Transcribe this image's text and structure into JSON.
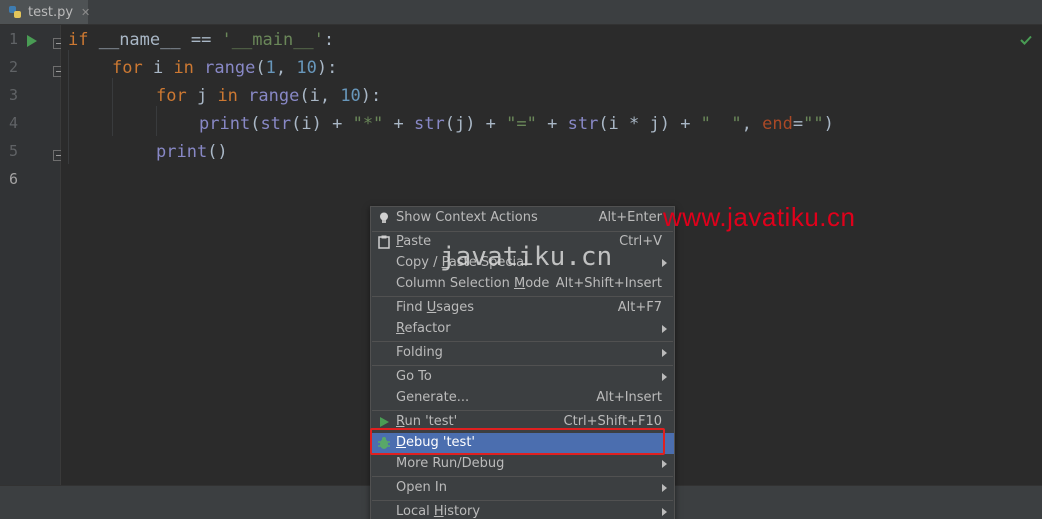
{
  "tab": {
    "filename": "test.py",
    "close_glyph": "✕"
  },
  "gutter": {
    "line_numbers": [
      "1",
      "2",
      "3",
      "4",
      "5",
      "6"
    ]
  },
  "code": {
    "line1": {
      "kw_if": "if",
      "name": " __name__ == ",
      "str_main": "'__main__'",
      "colon": ":"
    },
    "line2": {
      "kw_for": "for",
      "i": " i ",
      "kw_in": "in",
      "sp": " ",
      "range": "range",
      "open": "(",
      "n1": "1",
      "comma": ", ",
      "n10": "10",
      "close": "):"
    },
    "line3": {
      "kw_for": "for",
      "j": " j ",
      "kw_in": "in",
      "sp": " ",
      "range": "range",
      "args": "(i, ",
      "n10": "10",
      "close": "):"
    },
    "line4": {
      "print": "print",
      "p1": "(",
      "str1": "str",
      "a1": "(i) + ",
      "s_star": "\"*\"",
      "a2": " + ",
      "str2": "str",
      "a3": "(j) + ",
      "s_eq": "\"=\"",
      "a4": " + ",
      "str3": "str",
      "a5": "(i * j) + ",
      "s_sp": "\"  \"",
      "a6": ", ",
      "end": "end",
      "a7": "=",
      "s_empty": "\"\"",
      "a8": ")"
    },
    "line5": {
      "print": "print",
      "paren": "()"
    }
  },
  "watermarks": {
    "red": "www.javatiku.cn",
    "gray": "javatiku.cn"
  },
  "context_menu": {
    "show_context_actions": {
      "label": "Show Context Actions",
      "shortcut": "Alt+Enter",
      "icon": "bulb-icon"
    },
    "paste": {
      "label_u": "P",
      "label_rest": "aste",
      "shortcut": "Ctrl+V",
      "icon": "clipboard-icon"
    },
    "copy_paste_special": {
      "label_a": "Copy / ",
      "label_u": "P",
      "label_b": "aste Special"
    },
    "column_selection_mode": {
      "label_a": "Column Selection ",
      "label_u": "M",
      "label_b": "ode",
      "shortcut": "Alt+Shift+Insert"
    },
    "find_usages": {
      "label_a": "Find ",
      "label_u": "U",
      "label_b": "sages",
      "shortcut": "Alt+F7"
    },
    "refactor": {
      "label_u": "R",
      "label_rest": "efactor"
    },
    "folding": {
      "label": "Folding"
    },
    "go_to": {
      "label": "Go To"
    },
    "generate": {
      "label": "Generate...",
      "shortcut": "Alt+Insert"
    },
    "run_test": {
      "label_u": "R",
      "label_rest": "un 'test'",
      "shortcut": "Ctrl+Shift+F10",
      "icon": "run-icon"
    },
    "debug_test": {
      "label_u": "D",
      "label_rest": "ebug 'test'",
      "icon": "debug-icon"
    },
    "more_run_debug": {
      "label": "More Run/Debug"
    },
    "open_in": {
      "label": "Open In"
    },
    "local_history": {
      "label_a": "Local ",
      "label_u": "H",
      "label_b": "istory"
    }
  },
  "colors": {
    "editor_bg": "#2b2b2b",
    "keyword": "#cc7832",
    "string": "#6a8759",
    "number": "#6897bb",
    "builtin": "#8888c6",
    "menu_selected": "#4b6eaf",
    "highlight_box": "#e02020",
    "watermark_red": "#e0001b"
  }
}
